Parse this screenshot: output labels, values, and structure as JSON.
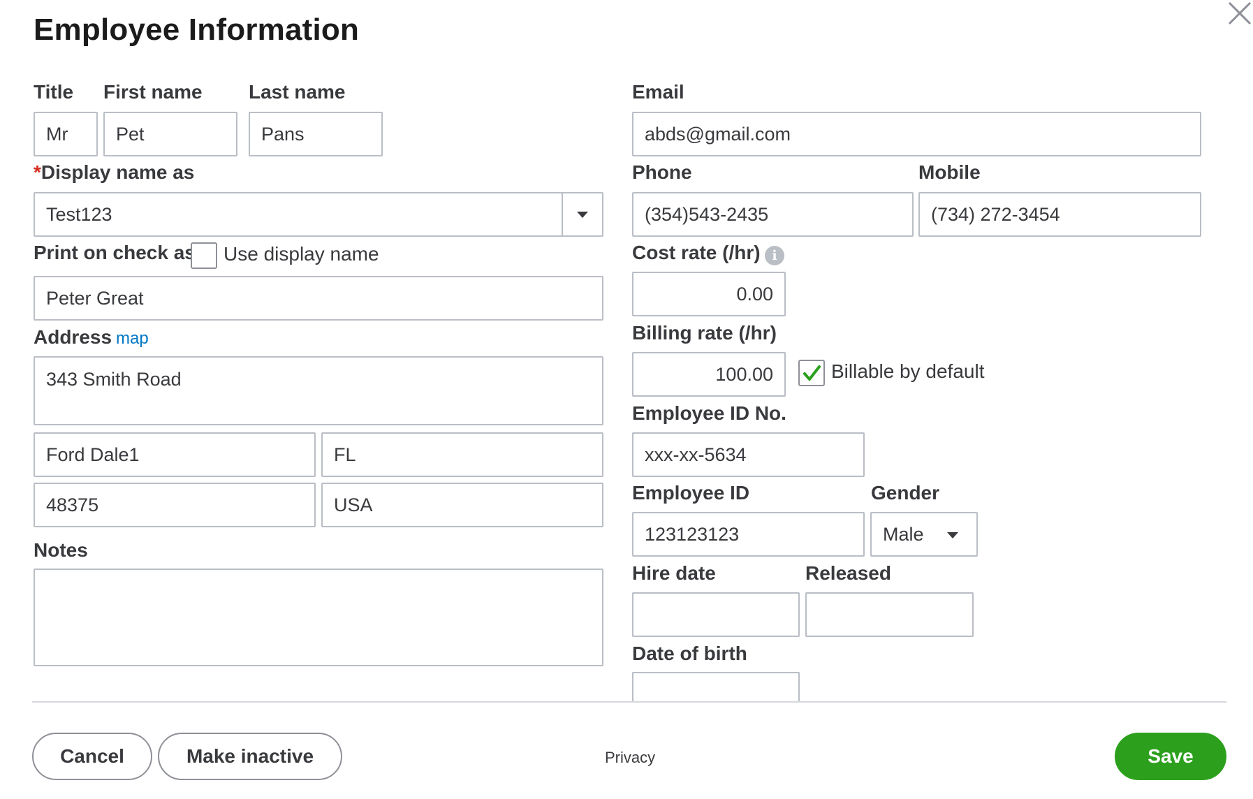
{
  "dialog": {
    "title": "Employee Information"
  },
  "name": {
    "title_label": "Title",
    "title_value": "Mr",
    "first_label": "First name",
    "first_value": "Pet",
    "last_label": "Last name",
    "last_value": "Pans"
  },
  "display_name": {
    "required_mark": "*",
    "label": "Display name as",
    "value": "Test123"
  },
  "print_on_check": {
    "label": "Print on check as",
    "checkbox_label": "Use display name",
    "checked": false,
    "value": "Peter Great"
  },
  "address": {
    "label": "Address",
    "map_link": "map",
    "street": "343 Smith Road",
    "city": "Ford Dale1",
    "state": "FL",
    "zip": "48375",
    "country": "USA"
  },
  "notes": {
    "label": "Notes",
    "value": ""
  },
  "email": {
    "label": "Email",
    "value": "abds@gmail.com"
  },
  "phone": {
    "label": "Phone",
    "value": "(354)543-2435"
  },
  "mobile": {
    "label": "Mobile",
    "value": "(734) 272-3454"
  },
  "cost_rate": {
    "label": "Cost rate (/hr)",
    "info_icon_glyph": "i",
    "value": "0.00"
  },
  "billing_rate": {
    "label": "Billing rate (/hr)",
    "value": "100.00",
    "billable_label": "Billable by default",
    "billable_checked": true
  },
  "employee_id_no": {
    "label": "Employee ID No.",
    "value": "xxx-xx-5634"
  },
  "employee_id": {
    "label": "Employee ID",
    "value": "123123123"
  },
  "gender": {
    "label": "Gender",
    "value": "Male"
  },
  "hire_date": {
    "label": "Hire date",
    "value": ""
  },
  "released": {
    "label": "Released",
    "value": ""
  },
  "date_of_birth": {
    "label": "Date of birth",
    "value": ""
  },
  "footer": {
    "cancel_label": "Cancel",
    "inactive_label": "Make inactive",
    "privacy_label": "Privacy",
    "save_label": "Save"
  },
  "colors": {
    "accent_green": "#2ca01c",
    "link_blue": "#0077c5",
    "required_red": "#d52b1e",
    "border": "#babec5"
  },
  "icons": {
    "close": "close-icon",
    "dropdown": "chevron-down-icon",
    "info": "info-icon",
    "check": "checkmark-icon"
  }
}
